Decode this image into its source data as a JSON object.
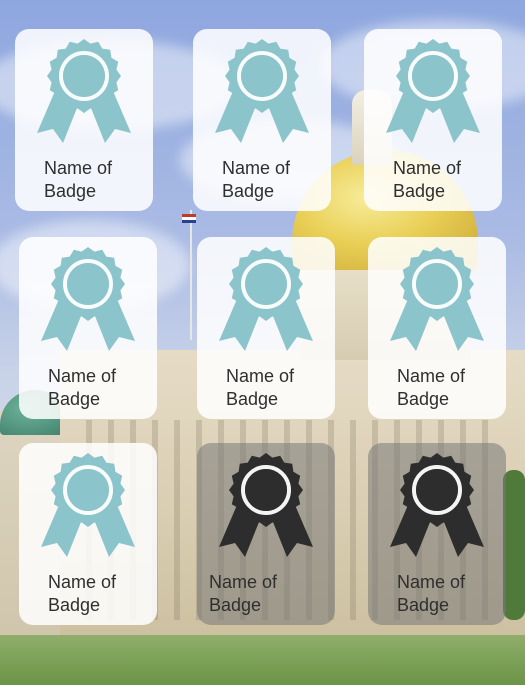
{
  "badges": [
    {
      "label": "Name of\nBadge",
      "locked": false,
      "icon": "ribbon-award-icon"
    },
    {
      "label": "Name of\nBadge",
      "locked": false,
      "icon": "ribbon-award-icon"
    },
    {
      "label": "Name of\nBadge",
      "locked": false,
      "icon": "ribbon-award-icon"
    },
    {
      "label": "Name of\nBadge",
      "locked": false,
      "icon": "ribbon-award-icon"
    },
    {
      "label": "Name of\nBadge",
      "locked": false,
      "icon": "ribbon-award-icon"
    },
    {
      "label": "Name of\nBadge",
      "locked": false,
      "icon": "ribbon-award-icon"
    },
    {
      "label": "Name of\nBadge",
      "locked": false,
      "icon": "ribbon-award-icon"
    },
    {
      "label": "Name of\nBadge",
      "locked": true,
      "icon": "ribbon-award-icon"
    },
    {
      "label": "Name of\nBadge",
      "locked": true,
      "icon": "ribbon-award-icon"
    }
  ],
  "colors": {
    "earned_icon": "#8cc4cc",
    "locked_icon": "#2d2d2d",
    "earned_card": "#ffffff",
    "locked_card": "#7a7a7a"
  }
}
